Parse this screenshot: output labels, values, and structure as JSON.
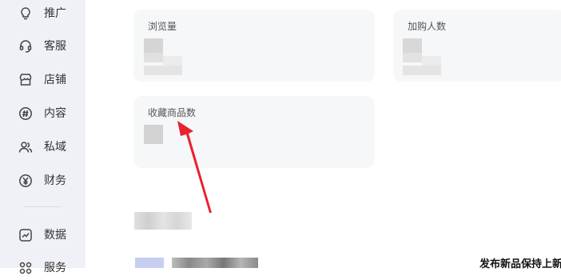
{
  "sidebar": {
    "items": [
      {
        "label": "推广",
        "icon": "lightbulb-icon"
      },
      {
        "label": "客服",
        "icon": "headset-icon"
      },
      {
        "label": "店铺",
        "icon": "store-icon"
      },
      {
        "label": "内容",
        "icon": "hashtag-icon"
      },
      {
        "label": "私域",
        "icon": "users-icon"
      },
      {
        "label": "财务",
        "icon": "yen-icon"
      },
      {
        "label": "数据",
        "icon": "chart-icon"
      },
      {
        "label": "服务",
        "icon": "grid-icon"
      }
    ]
  },
  "metrics": {
    "views_title": "浏览量",
    "cart_title": "加购人数",
    "favorites_title": "收藏商品数"
  },
  "promo": {
    "text": "发布新品保持上新"
  },
  "colors": {
    "arrow": "#e8232e",
    "card_bg": "#f6f7f9",
    "sidebar_bg": "#f0f1f7"
  }
}
